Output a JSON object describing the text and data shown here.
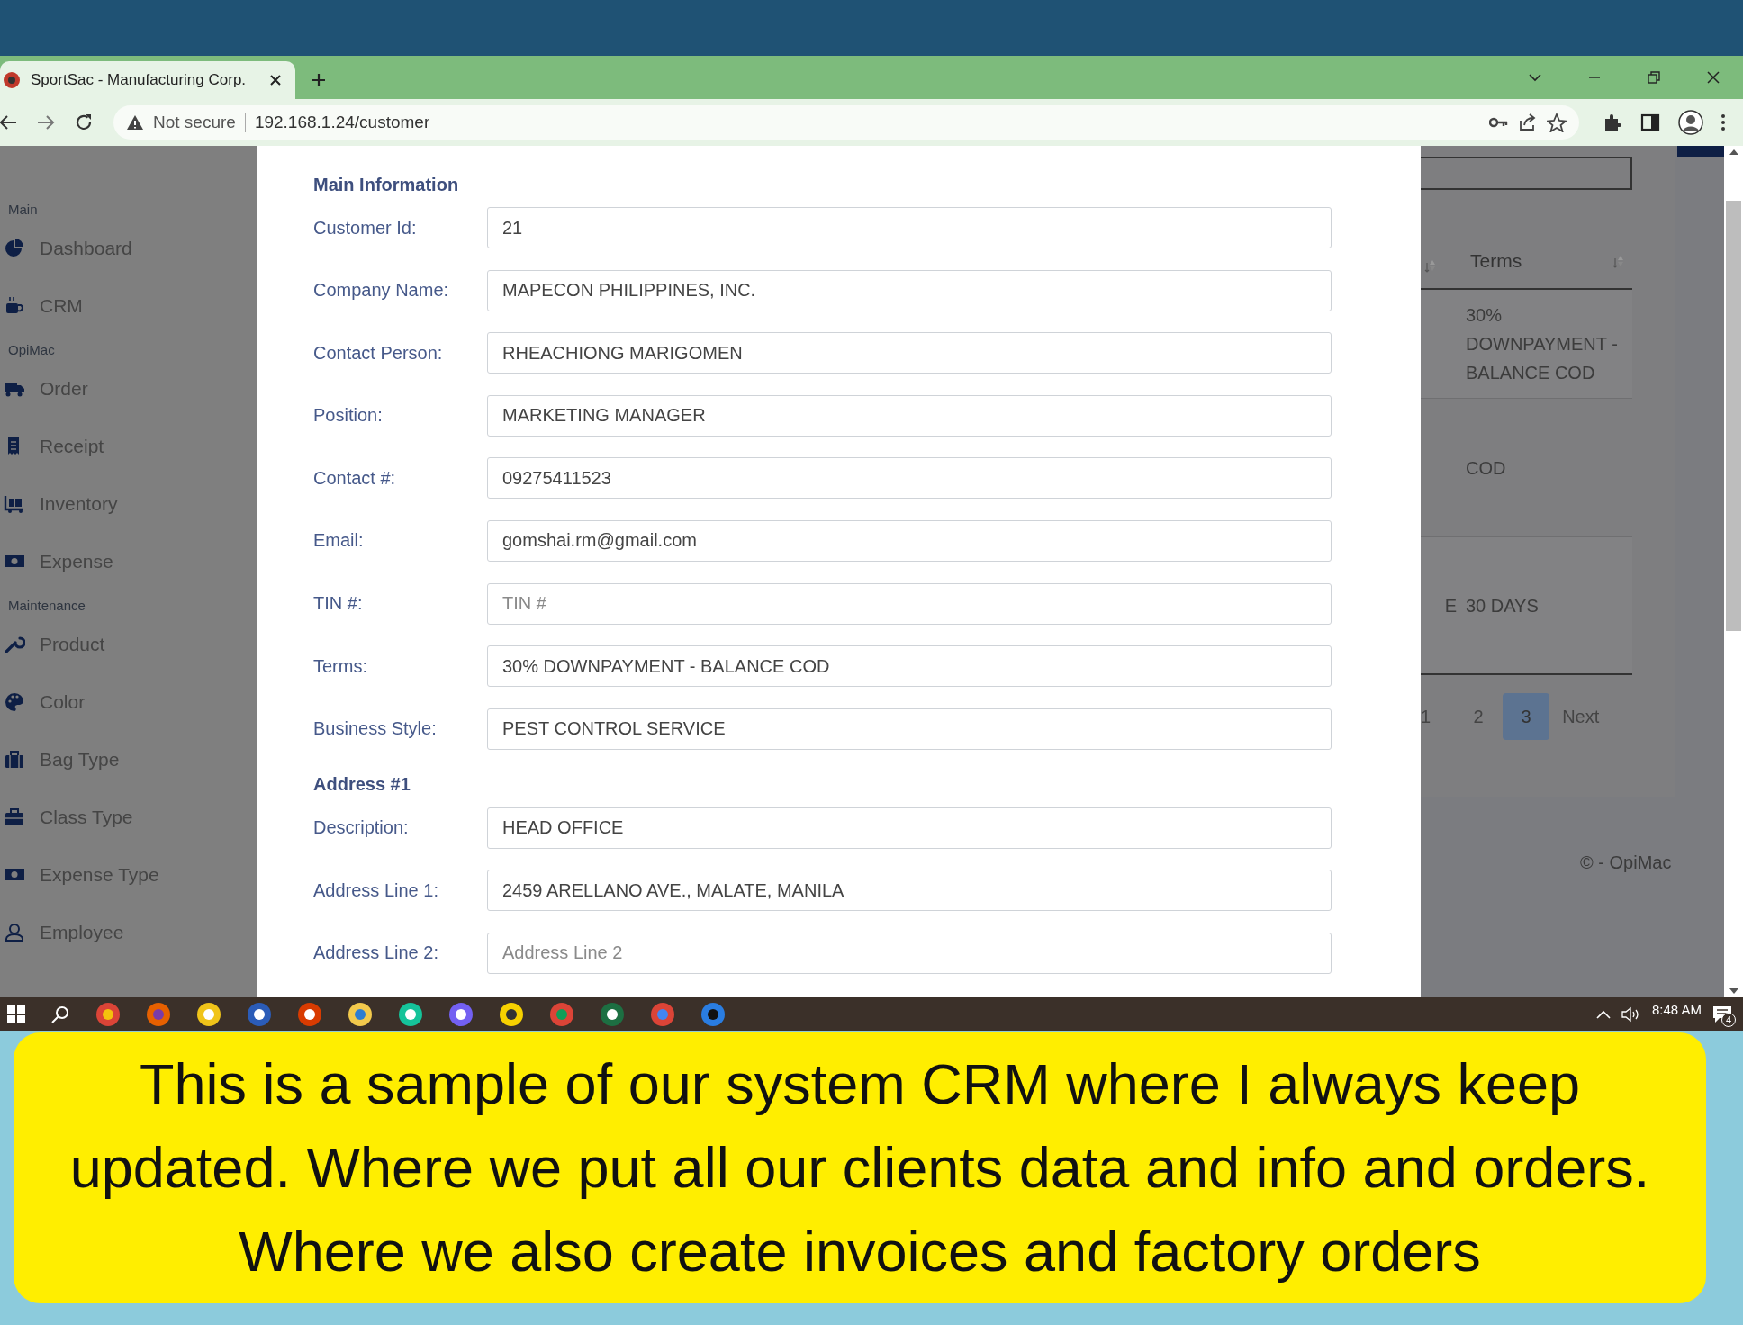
{
  "browser": {
    "tab": {
      "title": "SportSac - Manufacturing Corp."
    },
    "address_bar": {
      "security_label": "Not secure",
      "url": "192.168.1.24/customer"
    }
  },
  "sidebar": {
    "groups": [
      {
        "heading": "Main",
        "items": [
          {
            "label": "Dashboard"
          },
          {
            "label": "CRM"
          }
        ]
      },
      {
        "heading": "OpiMac",
        "items": [
          {
            "label": "Order"
          },
          {
            "label": "Receipt"
          },
          {
            "label": "Inventory"
          },
          {
            "label": "Expense"
          }
        ]
      },
      {
        "heading": "Maintenance",
        "items": [
          {
            "label": "Product"
          },
          {
            "label": "Color"
          },
          {
            "label": "Bag Type"
          },
          {
            "label": "Class Type"
          },
          {
            "label": "Expense Type"
          },
          {
            "label": "Employee"
          }
        ]
      }
    ]
  },
  "customer_form": {
    "sections": [
      {
        "title": "Main Information",
        "fields": [
          {
            "label": "Customer Id:",
            "value": "21"
          },
          {
            "label": "Company Name:",
            "value": "MAPECON PHILIPPINES, INC."
          },
          {
            "label": "Contact Person:",
            "value": "RHEACHIONG MARIGOMEN"
          },
          {
            "label": "Position:",
            "value": "MARKETING MANAGER"
          },
          {
            "label": "Contact #:",
            "value": "09275411523"
          },
          {
            "label": "Email:",
            "value": "gomshai.rm@gmail.com"
          },
          {
            "label": "TIN #:",
            "placeholder": "TIN #"
          },
          {
            "label": "Terms:",
            "value": "30% DOWNPAYMENT - BALANCE COD"
          },
          {
            "label": "Business Style:",
            "value": "PEST CONTROL SERVICE"
          }
        ]
      },
      {
        "title": "Address #1",
        "fields": [
          {
            "label": "Description:",
            "value": "HEAD OFFICE"
          },
          {
            "label": "Address Line 1:",
            "value": "2459 ARELLANO AVE., MALATE, MANILA"
          },
          {
            "label": "Address Line 2:",
            "placeholder": "Address Line 2"
          }
        ]
      }
    ]
  },
  "background_table": {
    "columns": [
      "Terms"
    ],
    "rows": [
      {
        "terms": "30% DOWNPAYMENT - BALANCE COD"
      },
      {
        "terms": "COD"
      },
      {
        "column_1": "E",
        "terms": "30 DAYS"
      }
    ],
    "pagination": [
      {
        "label": "1",
        "selected": false
      },
      {
        "label": "2",
        "selected": false
      },
      {
        "label": "3",
        "selected": true
      },
      {
        "label": "Next",
        "selected": false
      }
    ],
    "footer": "© - OpiMac"
  },
  "taskbar": {
    "time": "8:48 AM",
    "notification_count": "4"
  },
  "caption": "This is a sample of our system CRM where I always keep updated. Where we put all our clients data and info and orders. Where we also create invoices and factory orders"
}
